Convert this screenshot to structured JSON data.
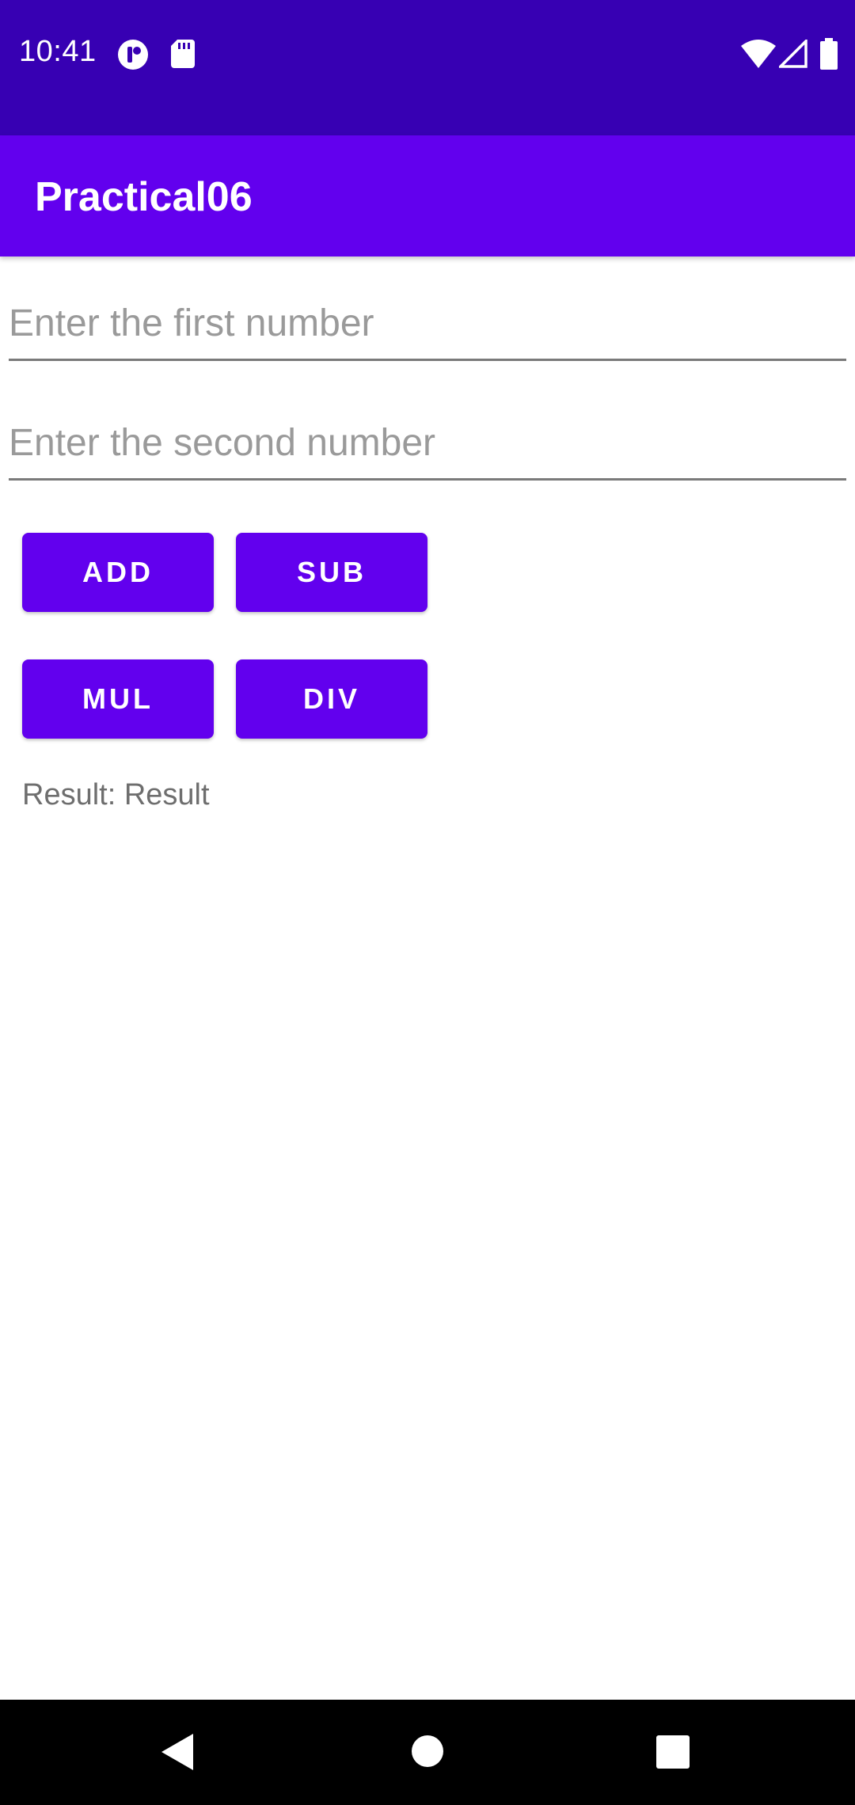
{
  "status_bar": {
    "time": "10:41",
    "icons": [
      "app-notification-icon",
      "sd-card-icon",
      "wifi-icon",
      "cellular-signal-icon",
      "battery-icon"
    ]
  },
  "app_bar": {
    "title": "Practical06"
  },
  "form": {
    "first_number": {
      "value": "",
      "placeholder": "Enter the first number"
    },
    "second_number": {
      "value": "",
      "placeholder": "Enter the second number"
    }
  },
  "buttons": {
    "add": "ADD",
    "sub": "SUB",
    "mul": "MUL",
    "div": "DIV"
  },
  "result": {
    "text": "Result: Result"
  },
  "nav_bar": {
    "icons": [
      "back-icon",
      "home-icon",
      "recents-icon"
    ]
  },
  "colors": {
    "status_bar": "#3700b3",
    "primary": "#6200ee",
    "nav_bar": "#000000"
  }
}
